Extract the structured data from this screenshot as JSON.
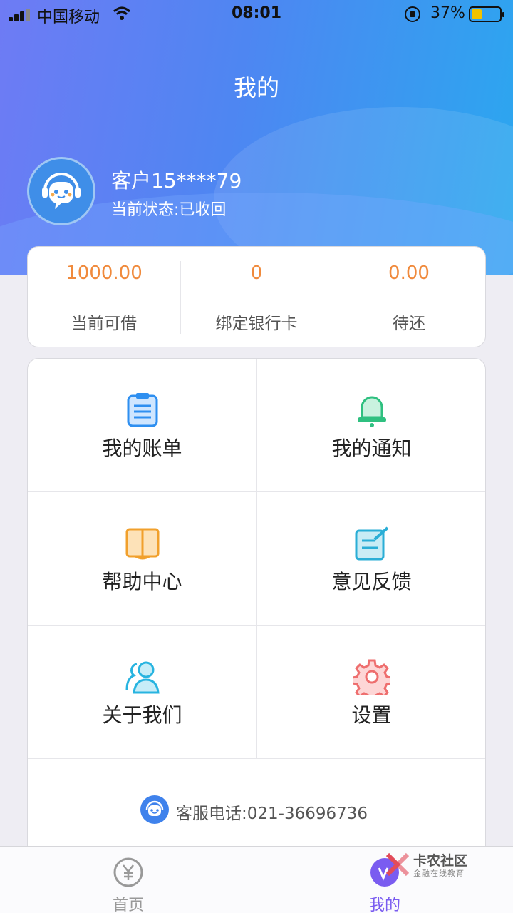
{
  "status_bar": {
    "carrier": "中国移动",
    "time": "08:01",
    "battery": "37%"
  },
  "header": {
    "title": "我的"
  },
  "user": {
    "name": "客户15****79",
    "status": "当前状态:已收回"
  },
  "stats": [
    {
      "value": "1000.00",
      "label": "当前可借"
    },
    {
      "value": "0",
      "label": "绑定银行卡"
    },
    {
      "value": "0.00",
      "label": "待还"
    }
  ],
  "menu": [
    {
      "label": "我的账单",
      "icon": "bill-icon"
    },
    {
      "label": "我的通知",
      "icon": "bell-icon"
    },
    {
      "label": "帮助中心",
      "icon": "book-icon"
    },
    {
      "label": "意见反馈",
      "icon": "edit-icon"
    },
    {
      "label": "关于我们",
      "icon": "users-icon"
    },
    {
      "label": "设置",
      "icon": "gear-icon"
    }
  ],
  "service": {
    "text": "客服电话:021-36696736"
  },
  "tabbar": [
    {
      "label": "首页",
      "icon": "yuan-icon",
      "active": false
    },
    {
      "label": "我的",
      "icon": "profile-icon",
      "active": true
    }
  ],
  "watermark": {
    "title": "卡农社区",
    "subtitle": "金融在线教育"
  },
  "colors": {
    "accent_orange": "#f08a3c",
    "tab_active": "#7a5cf0",
    "tab_inactive": "#999999"
  }
}
